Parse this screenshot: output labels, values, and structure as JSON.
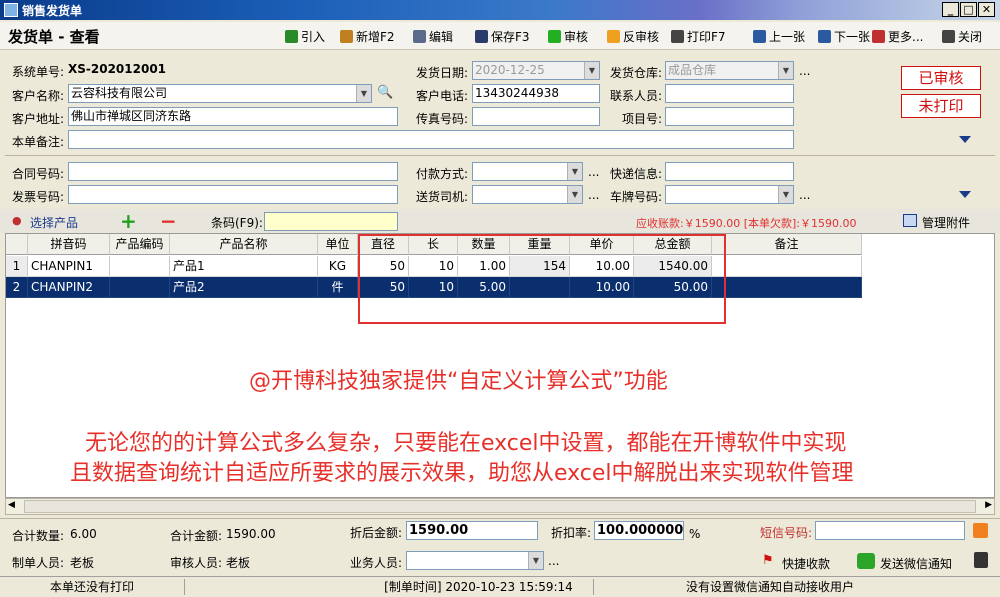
{
  "window": {
    "title": "销售发货单",
    "minimize": "0",
    "maximize": "1",
    "close": "r"
  },
  "toolbar": {
    "page_title": "发货单 - 查看",
    "buttons": [
      {
        "label": "引入",
        "icon": "arrow-right-icon",
        "color": "#2a8a2a"
      },
      {
        "label": "新增F2",
        "icon": "new-doc-icon",
        "color": "#c08020"
      },
      {
        "label": "编辑",
        "icon": "edit-icon",
        "color": "#5a6a8a"
      },
      {
        "label": "保存F3",
        "icon": "save-icon",
        "color": "#2a3a6a"
      },
      {
        "label": "审核",
        "icon": "approve-icon",
        "color": "#22b022"
      },
      {
        "label": "反审核",
        "icon": "unapprove-icon",
        "color": "#f0a020"
      },
      {
        "label": "打印F7",
        "icon": "print-icon",
        "color": "#444444"
      },
      {
        "label": "上一张",
        "icon": "prev-icon",
        "color": "#2a5aa0"
      },
      {
        "label": "下一张",
        "icon": "next-icon",
        "color": "#2a5aa0"
      },
      {
        "label": "更多...",
        "icon": "more-icon",
        "color": "#c03030"
      },
      {
        "label": "关闭",
        "icon": "close-door-icon",
        "color": "#444444"
      }
    ]
  },
  "form": {
    "order_no_label": "系统单号:",
    "order_no": "XS-202012001",
    "ship_date_label": "发货日期:",
    "ship_date": "2020-12-25",
    "warehouse_label": "发货仓库:",
    "warehouse": "成品仓库",
    "customer_label": "客户名称:",
    "customer": "云容科技有限公司",
    "phone_label": "客户电话:",
    "phone": "13430244938",
    "contact_label": "联系人员:",
    "contact": "",
    "address_label": "客户地址:",
    "address": "佛山市禅城区同济东路",
    "fax_label": "传真号码:",
    "fax": "",
    "project_label": "项目号:",
    "project": "",
    "remark_label": "本单备注:",
    "remark": "",
    "contract_label": "合同号码:",
    "contract": "",
    "pay_label": "付款方式:",
    "pay": "",
    "express_label": "快递信息:",
    "express": "",
    "invoice_label": "发票号码:",
    "invoice": "",
    "driver_label": "送货司机:",
    "driver": "",
    "plate_label": "车牌号码:",
    "plate": "",
    "ellipsis": "...",
    "stamp_approved": "已审核",
    "stamp_unprinted": "未打印"
  },
  "product_bar": {
    "select_label": "选择产品",
    "add": "+",
    "remove": "−",
    "barcode_label": "条码(F9):",
    "barcode": "",
    "receivable": "应收账款:￥1590.00 [本单欠款]:￥1590.00",
    "attach_label": "管理附件"
  },
  "grid": {
    "columns": [
      "拼音码",
      "产品编码",
      "产品名称",
      "单位",
      "直径",
      "长",
      "数量",
      "重量",
      "单价",
      "总金额",
      "备注"
    ],
    "rows": [
      {
        "no": "1",
        "pinyin": "CHANPIN1",
        "code": "",
        "name": "产品1",
        "unit": "KG",
        "diameter": "50",
        "length": "10",
        "qty": "1.00",
        "weight": "154",
        "price": "10.00",
        "amount": "1540.00",
        "remark": ""
      },
      {
        "no": "2",
        "pinyin": "CHANPIN2",
        "code": "",
        "name": "产品2",
        "unit": "件",
        "diameter": "50",
        "length": "10",
        "qty": "5.00",
        "weight": "",
        "price": "10.00",
        "amount": "50.00",
        "remark": ""
      }
    ]
  },
  "promo": {
    "line1": "@开博科技独家提供“自定义计算公式”功能",
    "line2": "无论您的的计算公式多么复杂，只要能在excel中设置，都能在开博软件中实现",
    "line3": "且数据查询统计自适应所要求的展示效果，助您从excel中解脱出来实现软件管理"
  },
  "footer": {
    "total_qty_label": "合计数量:",
    "total_qty": "6.00",
    "total_amount_label": "合计金额:",
    "total_amount": "1590.00",
    "discounted_label": "折后金额:",
    "discounted": "1590.00",
    "rate_label": "折扣率:",
    "rate": "100.000000",
    "percent": "%",
    "sms_label": "短信号码:",
    "sms": "",
    "creator_label": "制单人员:",
    "creator": "老板",
    "auditor_label": "审核人员:",
    "auditor": "老板",
    "salesman_label": "业务人员:",
    "salesman": "",
    "quick_pay": "快捷收款",
    "send_wechat": "发送微信通知"
  },
  "statusbar": {
    "print_status": "本单还没有打印",
    "created": "[制单时间] 2020-10-23 15:59:14",
    "wechat_status": "没有设置微信通知自动接收用户"
  }
}
